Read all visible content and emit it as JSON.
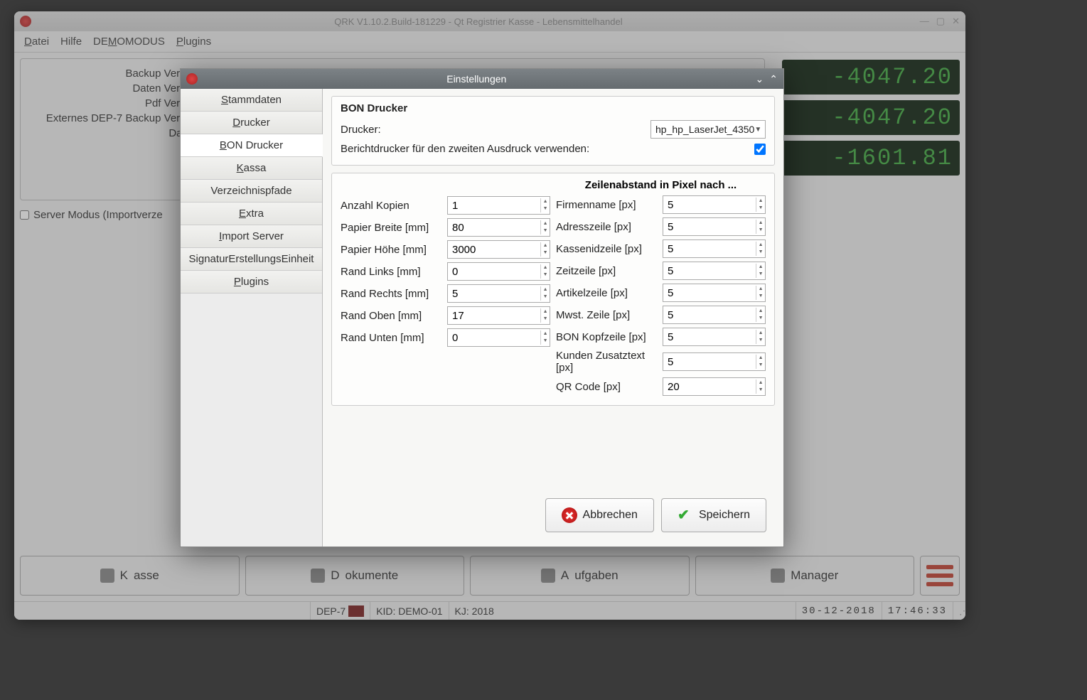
{
  "mainWindow": {
    "title": "QRK V1.10.2.Build-181229 - Qt Registrier Kasse - Lebensmittelhandel",
    "menu": {
      "datei": "Datei",
      "hilfe": "Hilfe",
      "demo": "DEMOMODUS",
      "plugins": "Plugins"
    },
    "groupbox": {
      "backup": "Backup Verze",
      "daten": "Daten Verze",
      "pdf": "Pdf Verze",
      "dep7": "Externes DEP-7 Backup Verze",
      "date": "Date"
    },
    "serverModus": "Server Modus (Importverze",
    "lcds": [
      "-4047.20",
      "-4047.20",
      "-1601.81"
    ],
    "bottomButtons": {
      "kasse": "Kasse",
      "dokumente": "Dokumente",
      "aufgaben": "Aufgaben",
      "manager": "Manager"
    },
    "statusbar": {
      "dep7": "DEP-7",
      "kid": "KID: DEMO-01",
      "kj": "KJ: 2018",
      "date": "30-12-2018",
      "time": "17:46:33"
    }
  },
  "dialog": {
    "title": "Einstellungen",
    "tabs": [
      "Stammdaten",
      "Drucker",
      "BON Drucker",
      "Kassa",
      "Verzeichnispfade",
      "Extra",
      "Import Server",
      "SignaturErstellungsEinheit",
      "Plugins"
    ],
    "section1": {
      "title": "BON Drucker",
      "druckerLabel": "Drucker:",
      "druckerValue": "hp_hp_LaserJet_4350",
      "berichtLabel": "Berichtdrucker für den zweiten Ausdruck verwenden:",
      "berichtChecked": true
    },
    "section2": {
      "colTitle": "Zeilenabstand in Pixel nach ...",
      "left": [
        {
          "label": "Anzahl Kopien",
          "value": "1"
        },
        {
          "label": "Papier Breite [mm]",
          "value": "80"
        },
        {
          "label": "Papier Höhe [mm]",
          "value": "3000"
        },
        {
          "label": "Rand Links [mm]",
          "value": "0"
        },
        {
          "label": "Rand Rechts [mm]",
          "value": "5"
        },
        {
          "label": "Rand Oben [mm]",
          "value": "17"
        },
        {
          "label": "Rand Unten [mm]",
          "value": "0"
        }
      ],
      "right": [
        {
          "label": "Firmenname [px]",
          "value": "5"
        },
        {
          "label": "Adresszeile [px]",
          "value": "5"
        },
        {
          "label": "Kassenidzeile [px]",
          "value": "5"
        },
        {
          "label": "Zeitzeile [px]",
          "value": "5"
        },
        {
          "label": "Artikelzeile [px]",
          "value": "5"
        },
        {
          "label": "Mwst. Zeile [px]",
          "value": "5"
        },
        {
          "label": "BON Kopfzeile [px]",
          "value": "5"
        },
        {
          "label": "Kunden Zusatztext [px]",
          "value": "5"
        },
        {
          "label": "QR Code [px]",
          "value": "20"
        }
      ]
    },
    "buttons": {
      "cancel": "Abbrechen",
      "save": "Speichern"
    }
  }
}
